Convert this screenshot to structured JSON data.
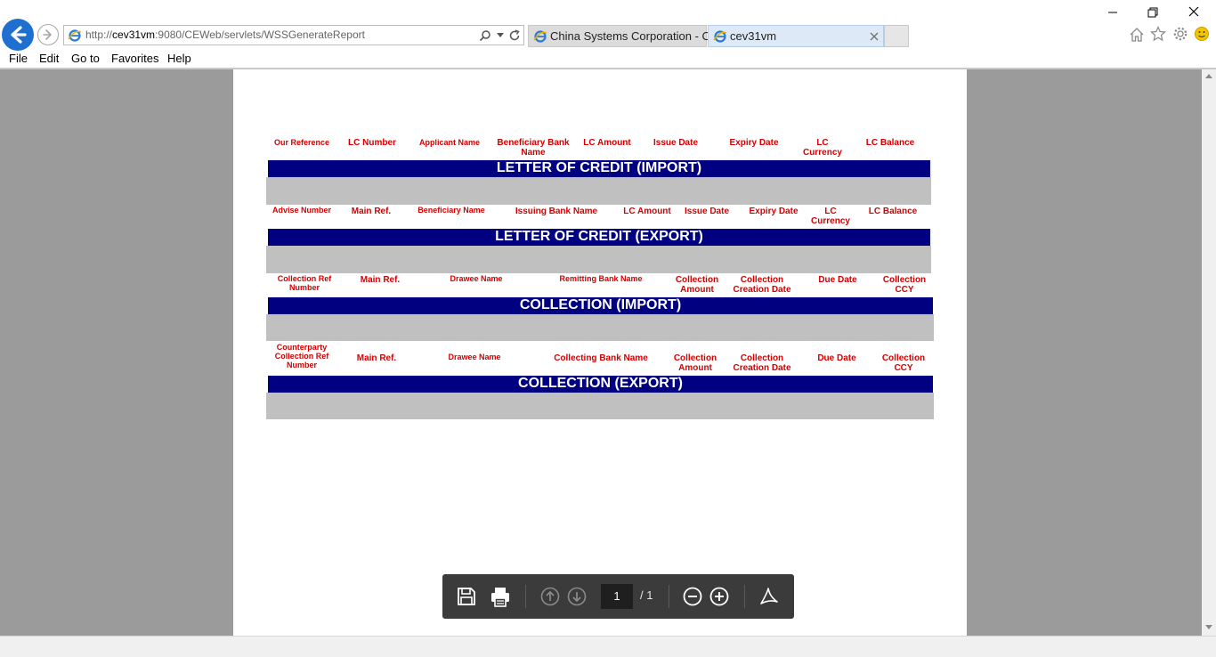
{
  "browser": {
    "address_prefix": "http://",
    "address_host": "cev31vm",
    "address_rest": ":9080/CEWeb/servlets/WSSGenerateReport",
    "tabs": [
      {
        "label": "China Systems Corporation - C..."
      },
      {
        "label": "cev31vm"
      }
    ],
    "menu": [
      "File",
      "Edit",
      "Go to",
      "Favorites",
      "Help"
    ]
  },
  "report": {
    "lc_import": {
      "headers": [
        "Our Reference",
        "LC Number",
        "Applicant Name",
        "Beneficiary Bank Name",
        "LC Amount",
        "Issue Date",
        "Expiry Date",
        "LC Currency",
        "LC Balance"
      ],
      "title": "LETTER OF CREDIT (IMPORT)"
    },
    "lc_export": {
      "headers": [
        "Advise Number",
        "Main Ref.",
        "Beneficiary Name",
        "Issuing Bank Name",
        "LC Amount",
        "Issue Date",
        "Expiry Date",
        "LC Currency",
        "LC Balance"
      ],
      "title": "LETTER OF CREDIT (EXPORT)"
    },
    "col_import": {
      "headers": [
        "Collection Ref Number",
        "Main Ref.",
        "Drawee Name",
        "Remitting Bank Name",
        "Collection Amount",
        "Collection Creation Date",
        "Due Date",
        "Collection CCY"
      ],
      "title": "COLLECTION (IMPORT)"
    },
    "col_export": {
      "headers": [
        "Counterparty Collection Ref Number",
        "Main Ref.",
        "Drawee Name",
        "Collecting Bank Name",
        "Collection Amount",
        "Collection Creation Date",
        "Due Date",
        "Collection CCY"
      ],
      "title": "COLLECTION (EXPORT)"
    }
  },
  "pdf_toolbar": {
    "current_page": "1",
    "total_pages": "/ 1"
  },
  "colors": {
    "band": "#000080",
    "header_text": "#d40000",
    "gray_row": "#c0c0c0"
  }
}
